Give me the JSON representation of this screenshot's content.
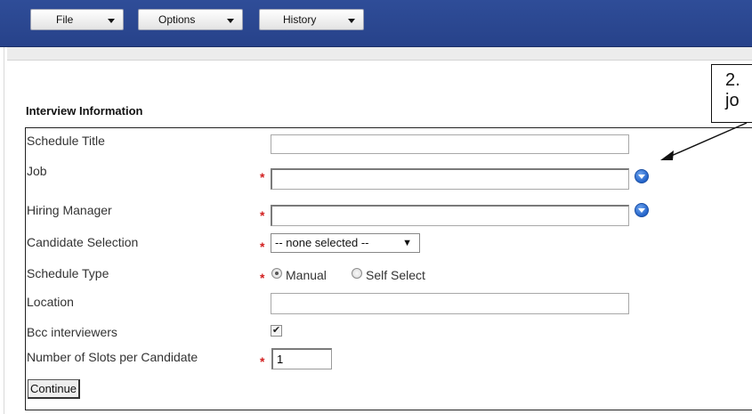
{
  "menubar": {
    "buttons": [
      {
        "label": "File"
      },
      {
        "label": "Options"
      },
      {
        "label": "History"
      }
    ]
  },
  "section": {
    "title": "Interview Information"
  },
  "form": {
    "schedule_title": {
      "label": "Schedule Title",
      "value": ""
    },
    "job": {
      "label": "Job",
      "value": ""
    },
    "hiring_manager": {
      "label": "Hiring Manager",
      "value": ""
    },
    "candidate_selection": {
      "label": "Candidate Selection",
      "selected": "-- none selected --",
      "arrow": "▼"
    },
    "schedule_type": {
      "label": "Schedule Type",
      "options": [
        "Manual",
        "Self Select"
      ],
      "selected": "Manual"
    },
    "location": {
      "label": "Location",
      "value": ""
    },
    "bcc": {
      "label": "Bcc interviewers",
      "checked": true,
      "mark": "✔"
    },
    "slots": {
      "label": "Number of Slots per Candidate",
      "value": "1"
    },
    "required_mark": "*",
    "continue_label": "Continue"
  },
  "callout": {
    "line1": "2.",
    "line2": "jo"
  },
  "colors": {
    "menubar": "#2f4d98",
    "required": "#d21f1f",
    "lookup": "#2363c9"
  }
}
